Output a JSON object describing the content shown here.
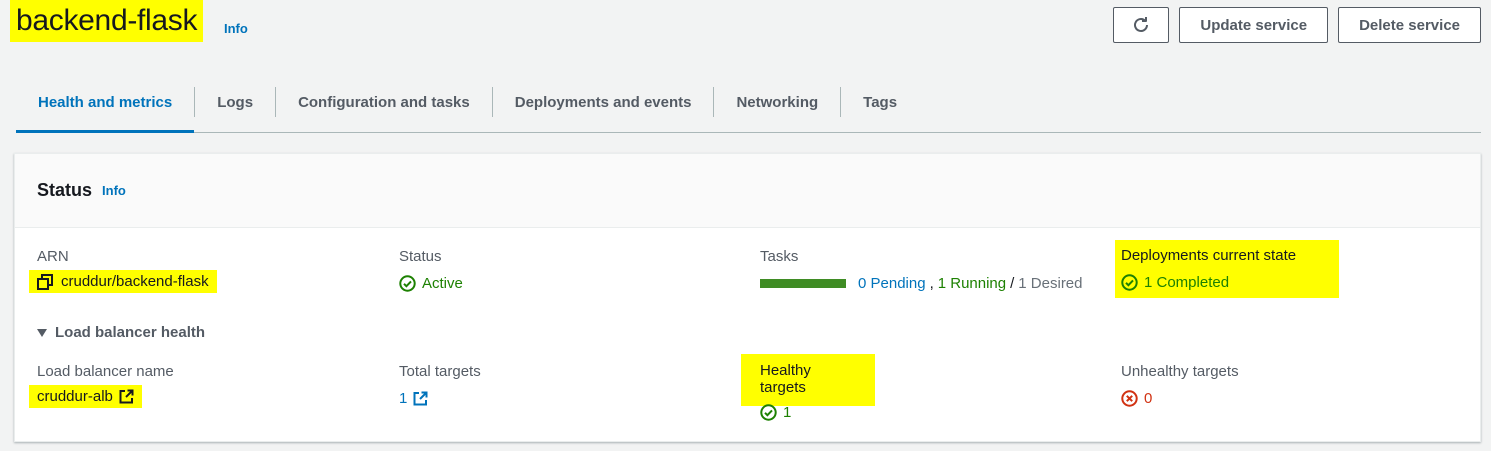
{
  "header": {
    "title": "backend-flask",
    "info_label": "Info",
    "update_button": "Update service",
    "delete_button": "Delete service"
  },
  "tabs": [
    {
      "label": "Health and metrics",
      "active": true
    },
    {
      "label": "Logs"
    },
    {
      "label": "Configuration and tasks"
    },
    {
      "label": "Deployments and events"
    },
    {
      "label": "Networking"
    },
    {
      "label": "Tags"
    }
  ],
  "status_card": {
    "title": "Status",
    "info_label": "Info",
    "arn": {
      "label": "ARN",
      "value": "cruddur/backend-flask"
    },
    "status": {
      "label": "Status",
      "value": "Active"
    },
    "tasks": {
      "label": "Tasks",
      "pending": "0 Pending",
      "comma": ",",
      "running": "1 Running",
      "slash": "/",
      "desired": "1 Desired"
    },
    "deployments": {
      "label": "Deployments current state",
      "value": "1 Completed"
    },
    "load_balancer_section": "Load balancer health",
    "lb_name": {
      "label": "Load balancer name",
      "value": "cruddur-alb"
    },
    "total_targets": {
      "label": "Total targets",
      "value": "1"
    },
    "healthy_targets": {
      "label": "Healthy targets",
      "value": "1"
    },
    "unhealthy_targets": {
      "label": "Unhealthy targets",
      "value": "0"
    }
  },
  "colors": {
    "accent": "#0073bb",
    "success": "#1d8102",
    "error": "#d13212",
    "highlight": "#ffff00"
  },
  "icons": [
    "refresh-icon",
    "copy-icon",
    "check-circle-icon",
    "external-link-icon",
    "x-circle-icon",
    "caret-down-icon"
  ]
}
